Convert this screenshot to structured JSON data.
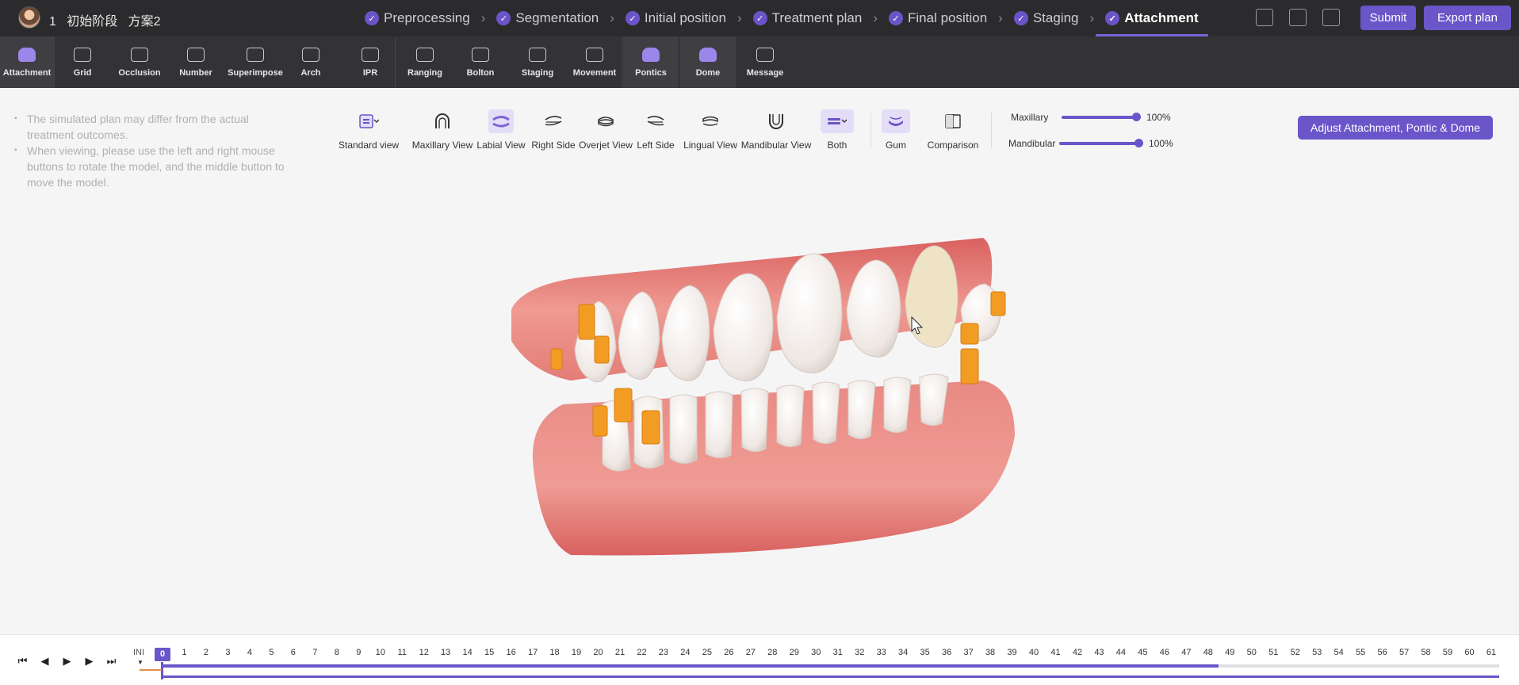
{
  "header": {
    "case_number": "1",
    "case_stage": "初始阶段",
    "case_plan": "方案2",
    "steps": [
      {
        "label": "Preprocessing",
        "done": true
      },
      {
        "label": "Segmentation",
        "done": true
      },
      {
        "label": "Initial position",
        "done": true
      },
      {
        "label": "Treatment plan",
        "done": true
      },
      {
        "label": "Final position",
        "done": true
      },
      {
        "label": "Staging",
        "done": true
      },
      {
        "label": "Attachment",
        "done": true,
        "active": true
      }
    ],
    "icons": [
      "cube-icon",
      "inbox-icon",
      "image-icon"
    ],
    "submit_label": "Submit",
    "export_label": "Export plan"
  },
  "toolbar": {
    "tools": [
      {
        "label": "Attachment",
        "icon": "tooth-attachment-icon"
      },
      {
        "label": "Grid",
        "icon": "grid-icon"
      },
      {
        "label": "Occlusion",
        "icon": "occlusion-icon"
      },
      {
        "label": "Number",
        "icon": "tooth-number-icon"
      },
      {
        "label": "Superimpose",
        "icon": "layers-icon"
      },
      {
        "label": "Arch",
        "icon": "arch-icon"
      },
      {
        "label": "IPR",
        "icon": "ipr-icon"
      },
      {
        "label": "Ranging",
        "icon": "ranging-icon"
      },
      {
        "label": "Bolton",
        "icon": "bolton-icon"
      },
      {
        "label": "Staging",
        "icon": "staging-icon"
      },
      {
        "label": "Movement",
        "icon": "movement-icon"
      },
      {
        "label": "Pontics",
        "icon": "pontics-icon"
      },
      {
        "label": "Dome",
        "icon": "dome-icon"
      },
      {
        "label": "Message",
        "icon": "message-icon"
      }
    ]
  },
  "notes": [
    "The simulated plan may differ from the actual treatment outcomes.",
    "When viewing, please use the left and right mouse buttons to rotate the model, and the middle button to move the model."
  ],
  "views": [
    {
      "label": "Standard view"
    },
    {
      "label": "Maxillary View"
    },
    {
      "label": "Labial View"
    },
    {
      "label": "Right Side"
    },
    {
      "label": "Overjet View"
    },
    {
      "label": "Left Side"
    },
    {
      "label": "Lingual View"
    },
    {
      "label": "Mandibular View"
    },
    {
      "label": "Both"
    },
    {
      "label": "Gum"
    },
    {
      "label": "Comparison"
    }
  ],
  "opacity": {
    "maxillary_label": "Maxillary",
    "maxillary_value": "100%",
    "maxillary_level": 1.0,
    "mandibular_label": "Mandibular",
    "mandibular_value": "100%",
    "mandibular_level": 1.0
  },
  "adjust_button_label": "Adjust Attachment, Pontic & Dome",
  "timeline": {
    "ini_label": "INI",
    "current_stage": "0",
    "stages": [
      "0",
      "1",
      "2",
      "3",
      "4",
      "5",
      "6",
      "7",
      "8",
      "9",
      "10",
      "11",
      "12",
      "13",
      "14",
      "15",
      "16",
      "17",
      "18",
      "19",
      "20",
      "21",
      "22",
      "23",
      "24",
      "25",
      "26",
      "27",
      "28",
      "29",
      "30",
      "31",
      "32",
      "33",
      "34",
      "35",
      "36",
      "37",
      "38",
      "39",
      "40",
      "41",
      "42",
      "43",
      "44",
      "45",
      "46",
      "47",
      "48",
      "49",
      "50",
      "51",
      "52",
      "53",
      "54",
      "55",
      "56",
      "57",
      "58",
      "59",
      "60",
      "61"
    ],
    "upper_track_progress": 0.79,
    "controls": [
      "skip-to-start-icon",
      "step-back-icon",
      "play-icon",
      "step-forward-icon",
      "skip-to-end-icon"
    ]
  },
  "colors": {
    "accent": "#6a55c9",
    "topbar": "#2b2b2d",
    "toolbar": "#333336",
    "gum": "#e8817c",
    "attachment": "#f39c24"
  }
}
